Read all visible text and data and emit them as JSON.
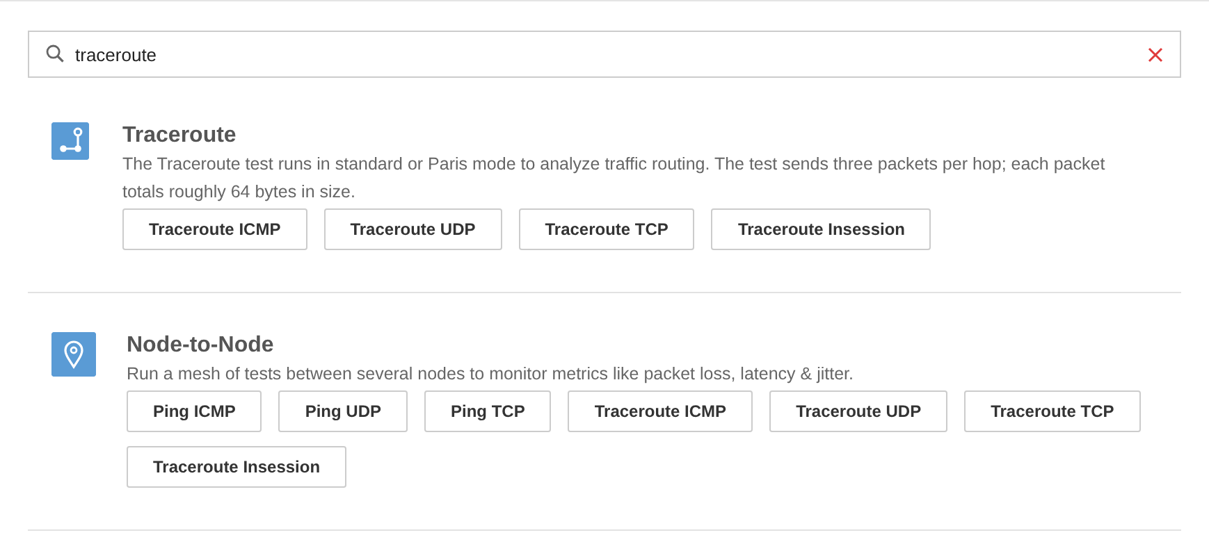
{
  "search": {
    "value": "traceroute"
  },
  "sections": [
    {
      "kind": "route",
      "title": "Traceroute",
      "description": "The Traceroute test runs in standard or Paris mode to analyze traffic routing. The test sends three packets per hop; each packet totals roughly 64 bytes in size.",
      "buttons": [
        "Traceroute ICMP",
        "Traceroute UDP",
        "Traceroute TCP",
        "Traceroute Insession"
      ]
    },
    {
      "kind": "pin",
      "title": "Node-to-Node",
      "description": "Run a mesh of tests between several nodes to monitor metrics like packet loss, latency & jitter.",
      "buttons": [
        "Ping ICMP",
        "Ping UDP",
        "Ping TCP",
        "Traceroute ICMP",
        "Traceroute UDP",
        "Traceroute TCP",
        "Traceroute Insession"
      ]
    }
  ]
}
